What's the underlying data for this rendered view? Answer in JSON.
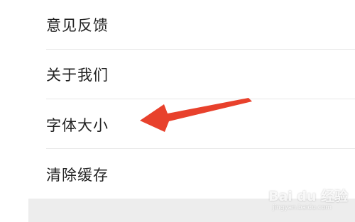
{
  "menu": {
    "items": [
      {
        "label": "意见反馈"
      },
      {
        "label": "关于我们"
      },
      {
        "label": "字体大小"
      },
      {
        "label": "清除缓存"
      }
    ]
  },
  "annotation": {
    "arrow_color": "#e8412c",
    "points_to": "字体大小"
  },
  "watermark": {
    "logo_text": "Bai du 经验",
    "url_text": "jingyan.baidu.com"
  }
}
